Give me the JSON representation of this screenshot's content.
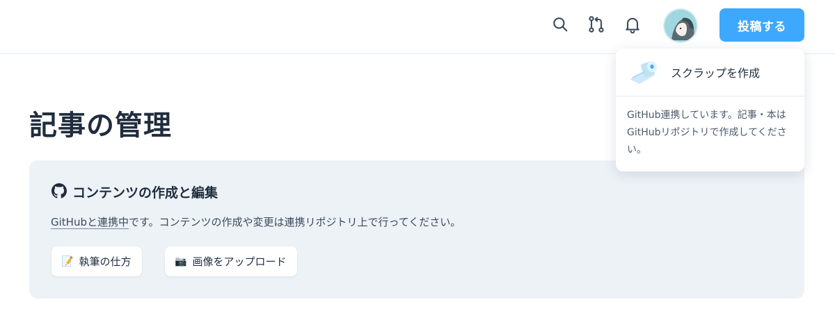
{
  "header": {
    "icons": [
      "search-icon",
      "pull-request-icon",
      "bell-icon"
    ],
    "post_button": "投稿する"
  },
  "page": {
    "title": "記事の管理"
  },
  "content_panel": {
    "title": "コンテンツの作成と編集",
    "desc_link": "GitHubと連携中",
    "desc_rest": "です。コンテンツの作成や変更は連携リポジトリ上で行ってください。",
    "buttons": [
      {
        "emoji": "📝",
        "label": "執筆の仕方"
      },
      {
        "emoji": "📷",
        "label": "画像をアップロード"
      }
    ]
  },
  "dropdown": {
    "item_label": "スクラップを作成",
    "note": "GitHub連携しています。記事・本はGitHubリポジトリで作成してください。"
  },
  "colors": {
    "accent": "#3ea8ff",
    "panel_bg": "#edf2f7",
    "text": "#1f2d3d"
  }
}
